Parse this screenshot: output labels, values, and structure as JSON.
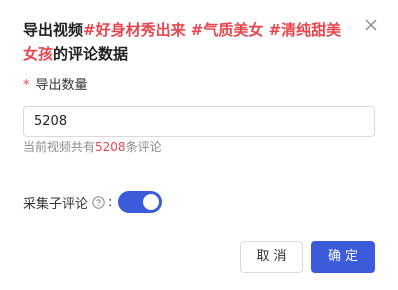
{
  "dialog": {
    "title_prefix": "导出视频",
    "title_tags": "#好身材秀出来 #气质美女 #清纯甜美女孩",
    "title_suffix": "的评论数据",
    "close_icon": "close-icon"
  },
  "form": {
    "required_mark": "*",
    "quantity_label": "导出数量",
    "quantity_value": "5208",
    "hint_prefix": "当前视频共有",
    "hint_count": "5208",
    "hint_suffix": "条评论",
    "sub_comments_label": "采集子评论",
    "help_icon": "question-circle-icon",
    "colon": ":",
    "sub_comments_enabled": true
  },
  "buttons": {
    "cancel_label": "取消",
    "ok_label": "确定"
  },
  "colors": {
    "accent": "#3b5bdb",
    "highlight": "#e8464e"
  }
}
